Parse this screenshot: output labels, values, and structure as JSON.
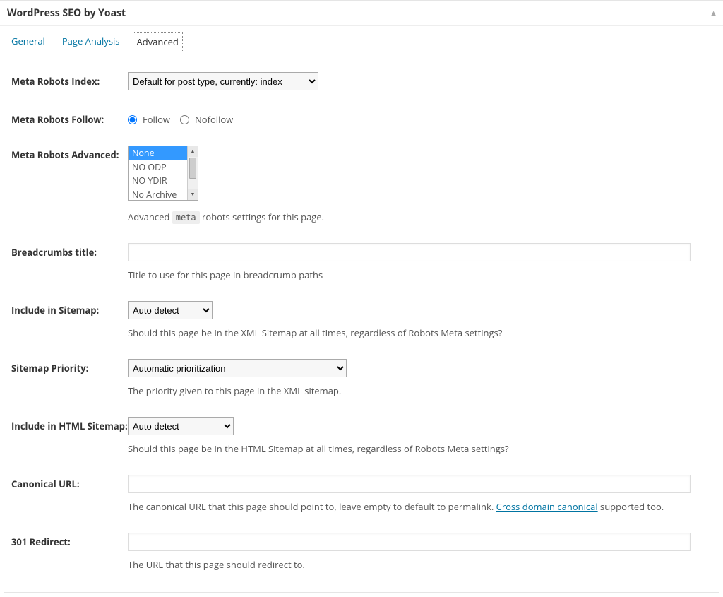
{
  "metabox": {
    "title": "WordPress SEO by Yoast"
  },
  "tabs": {
    "general": "General",
    "page_analysis": "Page Analysis",
    "advanced": "Advanced"
  },
  "fields": {
    "meta_robots_index": {
      "label": "Meta Robots Index:",
      "value": "Default for post type, currently: index"
    },
    "meta_robots_follow": {
      "label": "Meta Robots Follow:",
      "follow_label": "Follow",
      "nofollow_label": "Nofollow"
    },
    "meta_robots_advanced": {
      "label": "Meta Robots Advanced:",
      "options": {
        "none": "None",
        "noodp": "NO ODP",
        "noydir": "NO YDIR",
        "noarchive": "No Archive"
      },
      "help_before": "Advanced ",
      "help_code": "meta",
      "help_after": " robots settings for this page."
    },
    "breadcrumbs_title": {
      "label": "Breadcrumbs title:",
      "help": "Title to use for this page in breadcrumb paths"
    },
    "include_sitemap": {
      "label": "Include in Sitemap:",
      "value": "Auto detect",
      "help": "Should this page be in the XML Sitemap at all times, regardless of Robots Meta settings?"
    },
    "sitemap_priority": {
      "label": "Sitemap Priority:",
      "value": "Automatic prioritization",
      "help": "The priority given to this page in the XML sitemap."
    },
    "include_html_sitemap": {
      "label": "Include in HTML Sitemap:",
      "value": "Auto detect",
      "help": "Should this page be in the HTML Sitemap at all times, regardless of Robots Meta settings?"
    },
    "canonical_url": {
      "label": "Canonical URL:",
      "help_before": "The canonical URL that this page should point to, leave empty to default to permalink. ",
      "help_link": "Cross domain canonical",
      "help_after": " supported too."
    },
    "redirect_301": {
      "label": "301 Redirect:",
      "help": "The URL that this page should redirect to."
    }
  }
}
